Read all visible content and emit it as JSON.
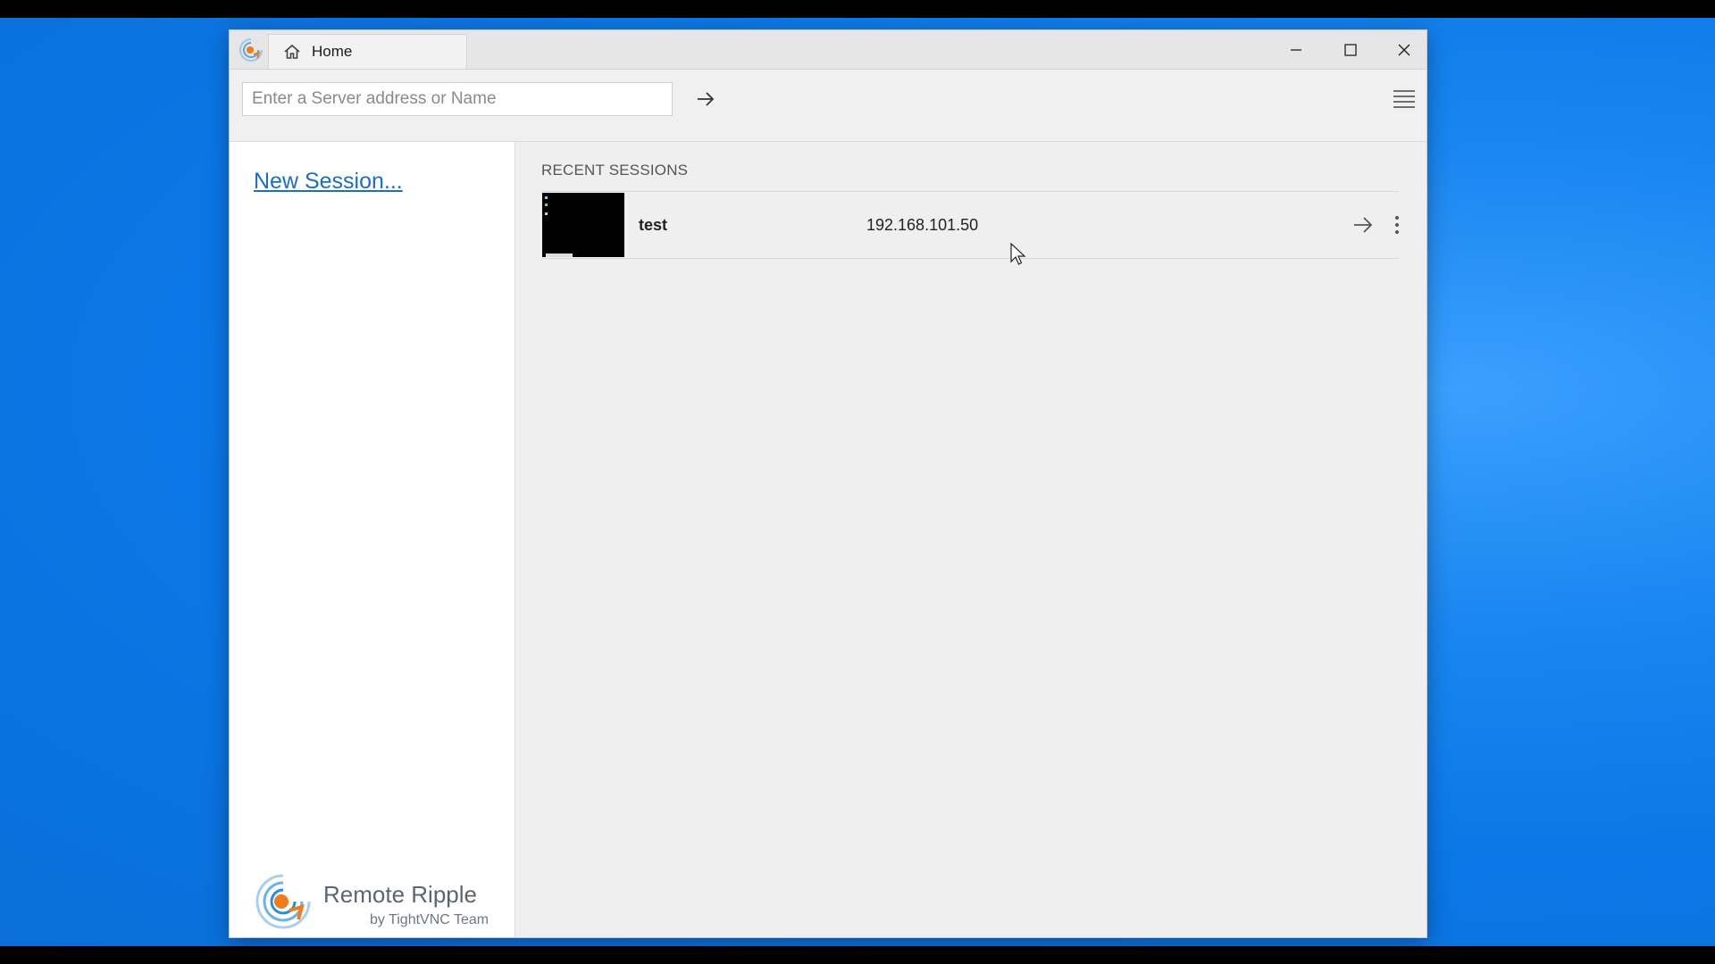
{
  "window": {
    "tab_label": "Home",
    "icons": {
      "app": "remote-ripple-logo-icon",
      "tab": "home-icon",
      "minimize": "minimize-icon",
      "maximize": "maximize-icon",
      "close": "close-icon"
    }
  },
  "toolbar": {
    "server_input_placeholder": "Enter a Server address or Name",
    "server_input_value": "",
    "go_icon": "arrow-right-icon",
    "menu_icon": "hamburger-menu-icon"
  },
  "sidebar": {
    "new_session_label": "New Session...",
    "brand_name": "Remote Ripple",
    "brand_sub": "by TightVNC Team"
  },
  "content": {
    "section_title": "RECENT SESSIONS",
    "sessions": [
      {
        "name": "test",
        "address": "192.168.101.50"
      }
    ]
  },
  "colors": {
    "desktop": "#0b77e6",
    "link": "#1a6fc4",
    "brand_orange": "#f07c1e",
    "brand_blue": "#2a8fd8"
  }
}
